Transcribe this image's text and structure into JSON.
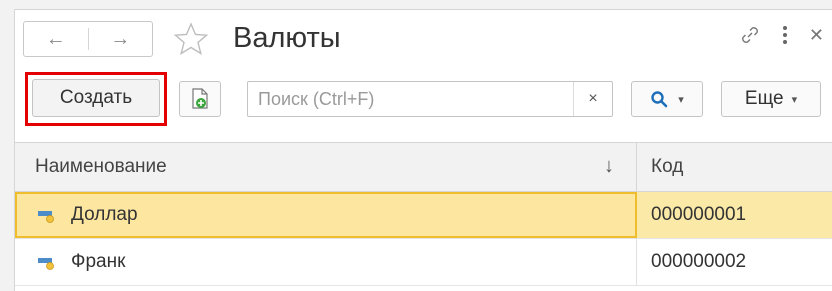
{
  "window": {
    "title": "Валюты",
    "icons": [
      "link-icon",
      "more-vertical-icon",
      "close-icon"
    ]
  },
  "nav": {
    "back_icon": "←",
    "forward_icon": "→"
  },
  "toolbar": {
    "create_label": "Создать",
    "search_placeholder": "Поиск (Ctrl+F)",
    "search_value": "",
    "clear_glyph": "×",
    "more_label": "Еще",
    "caret": "▾"
  },
  "table": {
    "columns": [
      "Наименование",
      "Код"
    ],
    "sort_glyph": "↓",
    "rows": [
      {
        "name": "Доллар",
        "code": "000000001",
        "selected": true
      },
      {
        "name": "Франк",
        "code": "000000002",
        "selected": false
      }
    ]
  },
  "colors": {
    "highlight_border": "#e40000",
    "selected_row": "#fbe8a3",
    "selected_outline": "#f0bd2f",
    "search_accent": "#1e6fb8",
    "add_icon_green": "#3aa53a"
  }
}
